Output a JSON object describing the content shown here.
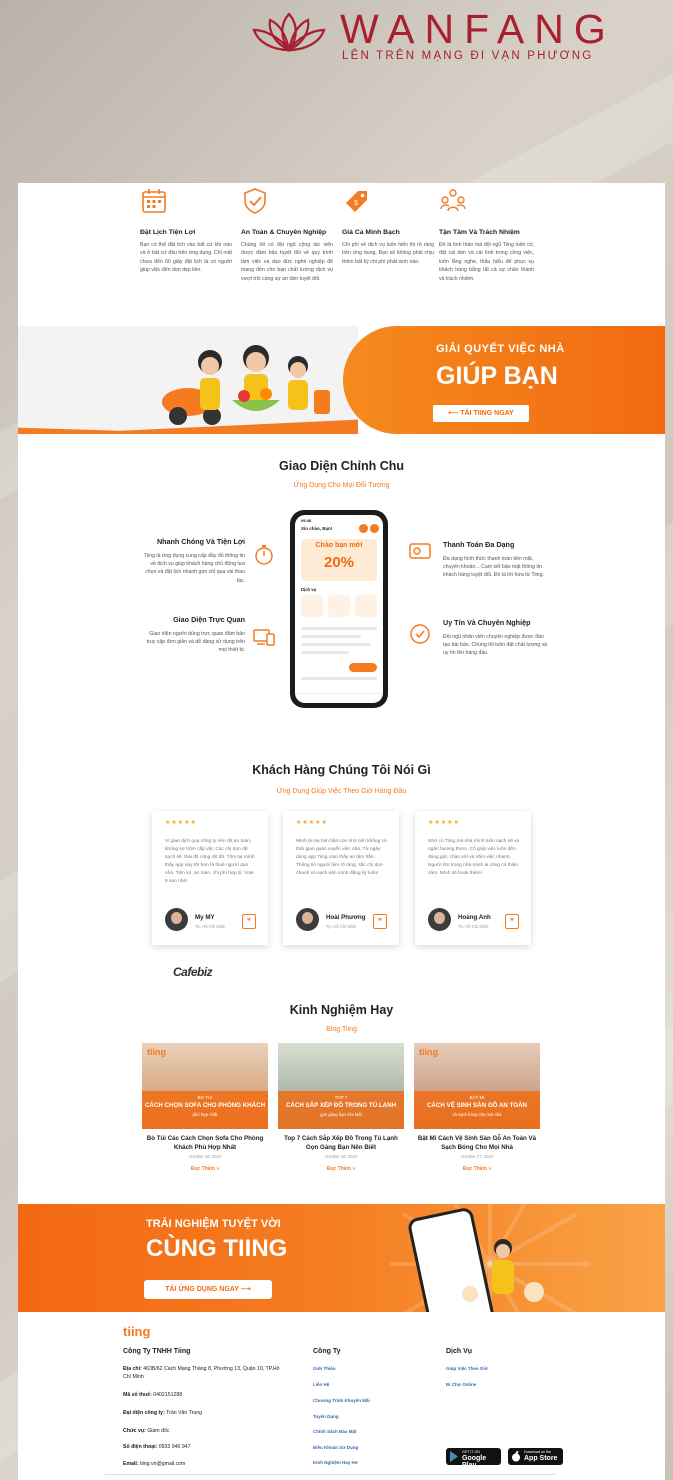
{
  "brand": {
    "name": "WANFANG",
    "tagline": "LÊN TRÊN MẠNG ĐI VẠN PHƯƠNG",
    "color": "#a8202f"
  },
  "features": [
    {
      "icon": "calendar-icon",
      "title": "Đặt Lịch Tiện Lợi",
      "text": "Bạn có thể đặt lịch vào bất cứ khi nào và ở bất cứ đâu trên ứng dụng. Chỉ mất chưa đến 60 giây đặt lịch là có người giúp việc đến dọn dẹp liền."
    },
    {
      "icon": "shield-check-icon",
      "title": "An Toàn & Chuyên Nghiệp",
      "text": "Chúng tôi có đội ngũ cộng tác viên được đảm bảo tuyệt đối về quy trình làm việc và đạo đức nghề nghiệp để mang đến cho bạn chất lượng dịch vụ vượt trội cùng sự an tâm tuyệt đối."
    },
    {
      "icon": "price-tag-icon",
      "title": "Giá Cả Minh Bạch",
      "text": "Chi phí về dịch vụ luôn hiển thị rõ ràng trên ứng dụng. Bạn sẽ không phải chịu thêm bất kỳ chi phí phát sinh nào."
    },
    {
      "icon": "team-icon",
      "title": "Tận Tâm Và Trách Nhiệm",
      "text": "Đó là tinh thần mà đội ngũ Tiing luôn có, đặt cái tâm và cái tình trong công việc, luôn lắng nghe, thấu hiểu để phục vụ khách hàng bằng tất cả sự chân thành và trách nhiệm."
    }
  ],
  "banner1": {
    "sub": "GIẢI QUYẾT VIỆC NHÀ",
    "big": "GIÚP BẠN",
    "cta": "⟵ TẢI TIING NGAY"
  },
  "interface": {
    "title": "Giao Diện Chỉnh Chu",
    "subtitle": "Ứng Dụng Cho Mọi Đối Tượng",
    "left": [
      {
        "title": "Nhanh Chóng Và Tiện Lợi",
        "text": "Tiing là ứng dụng cung cấp đầy đủ thông tin về dịch vụ giúp khách hàng chủ động lựa chọn và đặt lịch nhanh gọn chỉ qua vài thao tác."
      },
      {
        "title": "Giao Diện Trực Quan",
        "text": "Giao diện người dùng trực quan đảm bảo truy cập đơn giản và dễ dàng sử dụng trên mọi thiết bị."
      }
    ],
    "right": [
      {
        "title": "Thanh Toán Đa Dạng",
        "text": "Đa dạng hình thức thanh toán tiền mặt, chuyển khoản... Cam kết bảo mật thông tin khách hàng tuyệt đối. Đó là lời hứa từ Tiing."
      },
      {
        "title": "Uy Tín Và Chuyên Nghiệp",
        "text": "Đội ngũ nhân viên chuyên nghiệp được đào tạo bài bản. Chúng tôi luôn đặt chất lượng và uy tín lên hàng đầu."
      }
    ],
    "phone": {
      "time": "09:38",
      "greeting": "Xin chào, Bạn!",
      "promo_title": "Chào bạn mới",
      "promo_pct": "20%",
      "services_label": "Dịch vụ"
    }
  },
  "testimonials": {
    "title": "Khách Hàng Chúng Tôi Nói Gì",
    "subtitle": "Ứng Dụng Giúp Việc Theo Giờ Hàng Đầu",
    "stars": "★★★★★",
    "items": [
      {
        "quote": "Vì giao dịch qua công ty nên rất an toàn, không sợ trộm cắp vặt. Các chị dọn rất sạch sẽ, thái độ cũng rất tốt. Tôm tại mình thấy app này tốt hơn là thuê người dọn nhà. Tiện lợi, an toàn, chi phí hợp lý. Vote 5 sao nhé!",
        "name": "My MY",
        "loc": "Tp. Hồ Chí Minh"
      },
      {
        "quote": "Mình là mẹ bỉm bận con nhỏ nên không có thời gian quán xuyến việc nhà. Từ ngày dùng app Tiing cảm thấy an tâm hẳn. Thông tin người làm rõ ràng, sắc chị dọn nhanh và sạch nên mình đăng ký luôn!",
        "name": "Hoài Phương",
        "loc": "Tp. Hồ Chí Minh"
      },
      {
        "quote": "Nhờ có Tiing mà nhà mình luôn sạch sẽ và ngăn hương thơm. Cô giúp việc luôn đến đúng giờ, chào với và nắm việc nhanh. Người tìm trong nhà mình ai cũng có thiện cảm. Mình sẽ book thêm!",
        "name": "Hoàng Anh",
        "loc": "Tp. Hồ Chí Minh"
      }
    ]
  },
  "press_logo": "Cafebiz",
  "blog": {
    "title": "Kinh Nghiệm Hay",
    "subtitle": "Blog Tiing",
    "read_more": "Đọc Thêm »",
    "items": [
      {
        "kicker": "BỎ TÚI",
        "head": "CÁCH CHỌN SOFA CHO PHÒNG KHÁCH",
        "tail": "phù hợp nhất",
        "title": "Bỏ Túi Các Cách Chọn Sofa Cho Phòng Khách Phù Hợp Nhất",
        "date": "October 28, 2022",
        "color": "#c98a5a"
      },
      {
        "kicker": "TOP 7",
        "head": "CÁCH SẮP XẾP ĐỒ TRONG TỦ LẠNH",
        "tail": "gọn gàng bạn nên biết",
        "title": "Top 7 Cách Sắp Xếp Đồ Trong Tủ Lạnh Gọn Gàng Bạn Nên Biết",
        "date": "October 28, 2022",
        "color": "#8e9b8a"
      },
      {
        "kicker": "BẬT MÍ",
        "head": "CÁCH VỆ SINH SÀN GỖ AN TOÀN",
        "tail": "và sạch bóng cho mọi nhà",
        "title": "Bật Mí Cách Vệ Sinh Sàn Gỗ An Toàn Và Sạch Bóng Cho Mọi Nhà",
        "date": "October 27, 2022",
        "color": "#b88467"
      }
    ]
  },
  "banner2": {
    "s1": "TRẢI NGHIỆM TUYỆT VỜI",
    "s2": "CÙNG TIING",
    "cta": "TẢI ỨNG DỤNG NGAY ⟶"
  },
  "footer": {
    "logo": "tiing",
    "company": "Công Ty TNHH Tiing",
    "address_label": "Địa chỉ:",
    "address": "463B/62 Cách Mạng Tháng 8, Phường 13, Quận 10, TP.Hồ Chí Minh",
    "tax_label": "Mã số thuế:",
    "tax": "0402151288",
    "rep_label": "Đại diện công ty:",
    "rep": "Trần Văn Trung",
    "role_label": "Chức vụ:",
    "role": "Giám đốc",
    "phone_label": "Số điện thoại:",
    "phone": "0933 946 947",
    "email_label": "Email:",
    "email": "tiing.vn@gmail.com",
    "col2_title": "Công Ty",
    "col2_links": [
      "Giới Thiệu",
      "Liên Hệ",
      "Chương Trình Khuyến Mãi",
      "Tuyển Dụng",
      "Chính Sách Bảo Mật",
      "Điều Khoản Sử Dụng",
      "Kinh Nghiệm Hay Hơ"
    ],
    "col3_title": "Dịch Vụ",
    "col3_links": [
      "Giúp Việc Theo Giờ",
      "Đi Chợ Online"
    ],
    "google_small": "GET IT ON",
    "google_big": "Google Play",
    "apple_small": "Download on the",
    "apple_big": "App Store"
  },
  "colors": {
    "accent": "#f47b20",
    "accent_dark": "#f26a10"
  }
}
